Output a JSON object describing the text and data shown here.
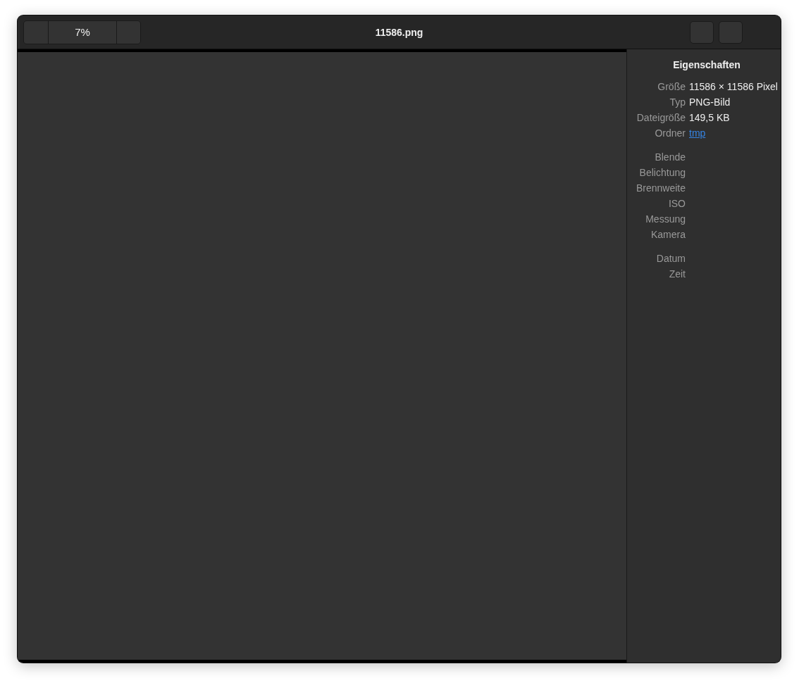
{
  "header": {
    "zoom": "7%",
    "title": "11586.png"
  },
  "properties": {
    "title": "Eigenschaften",
    "groups": [
      {
        "rows": [
          {
            "label": "Größe",
            "value": "11586 × 11586 Pixel",
            "kind": "text"
          },
          {
            "label": "Typ",
            "value": "PNG-Bild",
            "kind": "text"
          },
          {
            "label": "Dateigröße",
            "value": "149,5 KB",
            "kind": "text"
          },
          {
            "label": "Ordner",
            "value": "tmp",
            "kind": "link"
          }
        ]
      },
      {
        "rows": [
          {
            "label": "Blende"
          },
          {
            "label": "Belichtung"
          },
          {
            "label": "Brennweite"
          },
          {
            "label": "ISO"
          },
          {
            "label": "Messung"
          },
          {
            "label": "Kamera"
          }
        ]
      },
      {
        "rows": [
          {
            "label": "Datum"
          },
          {
            "label": "Zeit"
          }
        ]
      }
    ]
  }
}
